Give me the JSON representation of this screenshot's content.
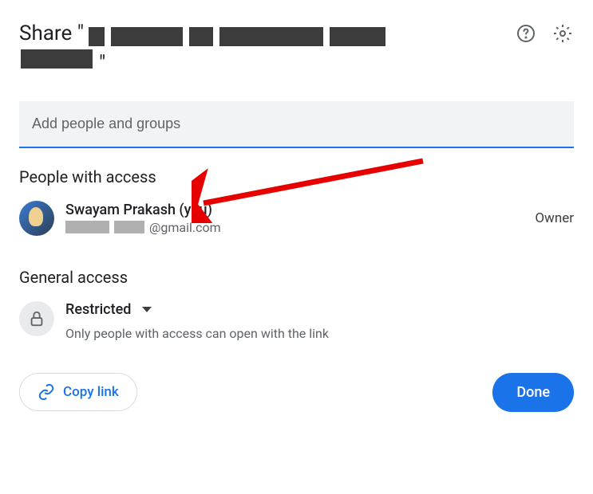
{
  "header": {
    "title_prefix": "Share \"",
    "title_suffix": "\"",
    "redacted_file_name": true
  },
  "input": {
    "placeholder": "Add people and groups"
  },
  "sections": {
    "people_with_access": "People with access",
    "general_access": "General access"
  },
  "owner": {
    "name": "Swayam Prakash (you)",
    "email_domain": "@gmail.com",
    "role": "Owner"
  },
  "general": {
    "level": "Restricted",
    "description": "Only people with access can open with the link"
  },
  "footer": {
    "copy_link": "Copy link",
    "done": "Done"
  }
}
